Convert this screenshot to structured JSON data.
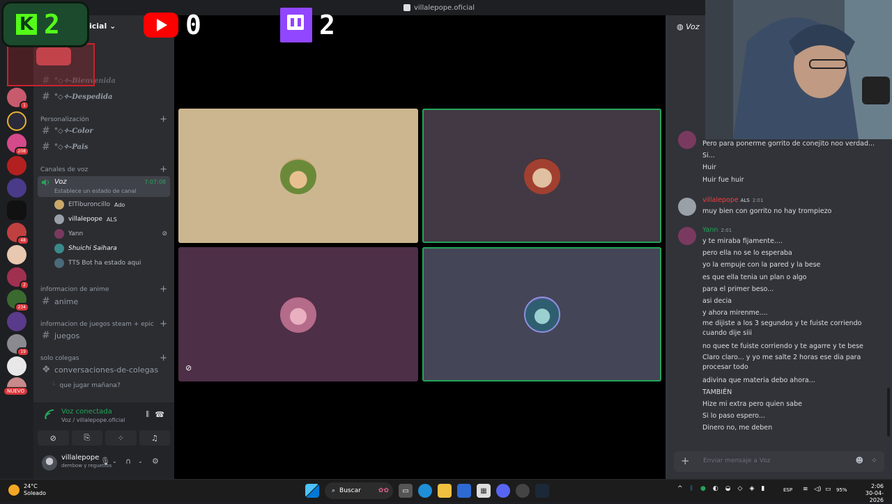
{
  "window": {
    "title": "villalepope.oficial"
  },
  "overlay": {
    "kick_count": "2",
    "youtube_count": "0",
    "twitch_count": "2",
    "kick_letter": "K"
  },
  "server": {
    "name_fragment": "icial"
  },
  "server_badges": [
    "1",
    "208",
    "48",
    "2",
    "234",
    "19"
  ],
  "new_label": "NUEVO",
  "channels": {
    "bienvenida": "°◇✧-Bienvenida",
    "despedida": "°◇✧-Despedida",
    "color": "°◇✧-Color",
    "pais": "°◇✧-Pais",
    "anime": "anime",
    "juegos": "juegos",
    "colegas": "conversaciones-de-colegas",
    "thread": "que jugar mañana?"
  },
  "categories": {
    "personalizacion": "Personalización",
    "voz": "Canales de voz",
    "anime": "informacion de anime",
    "juegos": "informacion de juegos steam + epic",
    "colegas": "solo colegas"
  },
  "voice_channel": {
    "name": "Voz",
    "time": "7:07:08",
    "status": "Establece un estado de canal"
  },
  "members": [
    {
      "name": "ElTiburoncillo",
      "tag": "Ado",
      "color": "#c9a86a"
    },
    {
      "name": "villalepope",
      "tag": "ALS",
      "color": "#9aa0a8"
    },
    {
      "name": "Yann",
      "tag": "",
      "color": "#7a3a60"
    },
    {
      "name": "Shuichi Saihara",
      "tag": "",
      "color": "#3a8a8a"
    },
    {
      "name": "TTS Bot ha estado aqui",
      "tag": "",
      "color": "#4a6b7a"
    }
  ],
  "voice_panel": {
    "title": "Voz conectada",
    "subtitle": "Voz / villalepope.oficial"
  },
  "user": {
    "name": "villalepope",
    "status": "dembow y reguettos"
  },
  "stage_tiles": [
    {
      "bg": "#ccb68f",
      "avatar": "#6a8a3a",
      "speaking": false,
      "muted": false
    },
    {
      "bg": "#433944",
      "avatar": "#a14030",
      "speaking": true,
      "muted": false
    },
    {
      "bg": "#4d2f47",
      "avatar": "#b56b8a",
      "speaking": false,
      "muted": true
    },
    {
      "bg": "#454558",
      "avatar": "#2f5e70",
      "speaking": true,
      "muted": false
    }
  ],
  "chat": {
    "header": "Voz",
    "first_lines": [
      "Pero para ponerme gorrito de conejito noo verdad...",
      "Si...",
      "Huir",
      "Huir fue huir"
    ],
    "msg2": {
      "author": "villalepope",
      "tag": "ALS",
      "time": "2:01",
      "text": "muy bien con gorrito no hay trompiezo"
    },
    "msg3": {
      "author": "Yann",
      "time": "2:01",
      "lines": [
        "y te miraba fijamente....",
        "pero ella no se lo esperaba",
        "yo la empuje con la pared y la bese",
        "es que ella tenia un plan o algo",
        "para el primer beso...",
        "asi decia",
        "y ahora mirenme....",
        "me dijiste a los 3 segundos y te fuiste corriendo",
        "cuando dije siii",
        "no quee te fuiste corriendo y te agarre y te bese",
        "Claro claro... y yo me salte 2 horas ese dia para",
        "procesar todo",
        "adivina que materia debo ahora...",
        "TAMBIÉN",
        "Hize mi extra pero quien sabe",
        "Si lo paso espero...",
        "Dinero no, me deben"
      ]
    },
    "placeholder": "Enviar mensaje a Voz"
  },
  "taskbar": {
    "temp": "24°C",
    "weather": "Soleado",
    "search": "Buscar",
    "lang": "ESP",
    "battery": "95%",
    "time": "2:06",
    "date": "30-04-2026"
  }
}
